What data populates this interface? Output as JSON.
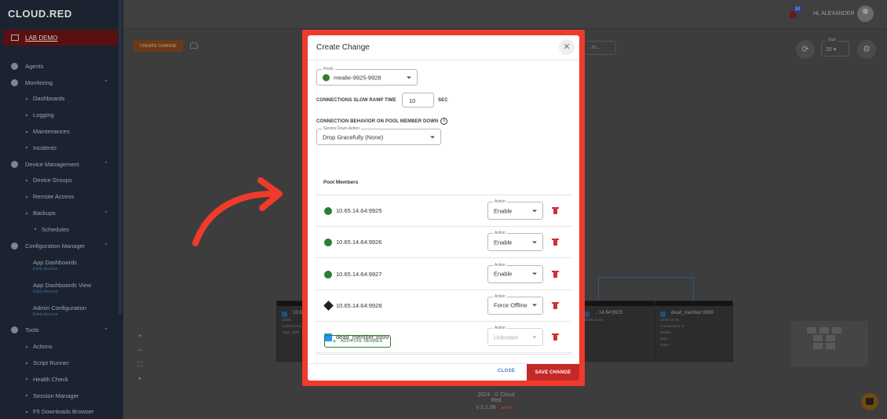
{
  "app": {
    "logo_main": "CL",
    "logo_accent": "OUD",
    "logo_tail": "RED",
    "logo_full": "CLOUD.RED"
  },
  "sidebar": {
    "lab": "LAB DEMO",
    "items": [
      {
        "kind": "sec",
        "label": "Agents",
        "icon": "agents-icon"
      },
      {
        "kind": "sec",
        "label": "Monitoring",
        "icon": "monitoring-icon",
        "caret": "^"
      },
      {
        "kind": "sub",
        "label": "Dashboards"
      },
      {
        "kind": "sub",
        "label": "Logging"
      },
      {
        "kind": "sub",
        "label": "Maintenances"
      },
      {
        "kind": "sub",
        "label": "Incidents"
      },
      {
        "kind": "sec",
        "label": "Device Management",
        "icon": "device-management-icon",
        "caret": "^"
      },
      {
        "kind": "sub",
        "label": "Device Groups"
      },
      {
        "kind": "sub",
        "label": "Remote Access"
      },
      {
        "kind": "sub",
        "label": "Backups",
        "caret": "^"
      },
      {
        "kind": "subsub",
        "label": "Schedules"
      },
      {
        "kind": "sec",
        "label": "Configuration Manager",
        "icon": "configuration-manager-icon",
        "caret": "^"
      },
      {
        "kind": "two",
        "label": "App Dashboards",
        "beta": "Early Access"
      },
      {
        "kind": "two",
        "label": "App Dashboards View",
        "beta": "Early Access"
      },
      {
        "kind": "two",
        "label": "Admin Configuration",
        "beta": "Early Access"
      },
      {
        "kind": "sec",
        "label": "Tools",
        "icon": "tools-icon",
        "caret": "^"
      },
      {
        "kind": "sub",
        "label": "Actions"
      },
      {
        "kind": "sub",
        "label": "Script Runner"
      },
      {
        "kind": "sub",
        "label": "Health Check"
      },
      {
        "kind": "sub",
        "label": "Session Manager"
      },
      {
        "kind": "sub",
        "label": "F5 Downloads Browser"
      }
    ]
  },
  "topbar": {
    "notifications": "10",
    "greeting": "Hi, ALEXANDER"
  },
  "background": {
    "create_button": "CREATE CHANGE",
    "select_value": "...th...",
    "size_label": "Size",
    "size_value": "20",
    "nodes": [
      {
        "title": "10.6...",
        "sub": "10.65..",
        "lines": [
          "Connections...",
          "Details",
          "Max: ..",
          "Total: 1000"
        ]
      },
      {
        "title": "...14.64:9925",
        "sub": "10.65.14.64",
        "lines": [
          "...",
          "...",
          "..."
        ]
      },
      {
        "title": "dead_member:9999",
        "sub": "10.65.14.78",
        "lines": [
          "Connections: 0",
          "Details",
          "Max: -",
          "Total: -"
        ]
      }
    ],
    "footer_year": "2024 · © Cloud Red",
    "footer_version": "v 2.1.36",
    "footer_pill": "admin"
  },
  "modal": {
    "title": "Create Change",
    "pool_label": "Pools",
    "pool_value": "mealie-9925-9928",
    "ramp_label": "CONNECTIONS SLOW RAMP TIME",
    "ramp_value": "10",
    "ramp_unit": "SEC",
    "behavior_label": "CONNECTION BEHAVIOR ON POOL MEMBER DOWN",
    "service_down_label": "Service Down Action",
    "service_down_value": "Drop Gracefully (None)",
    "pool_members_header": "Pool Members",
    "action_label": "Action",
    "members": [
      {
        "address": "10.65.14.64:9925",
        "status": "green",
        "action": "Enable"
      },
      {
        "address": "10.65.14.64:9926",
        "status": "green",
        "action": "Enable"
      },
      {
        "address": "10.65.14.64:9927",
        "status": "green",
        "action": "Enable"
      },
      {
        "address": "10.65.14.64:9928",
        "status": "black",
        "action": "Force Offline"
      },
      {
        "address": "dead_member:9999",
        "status": "blue",
        "action": "Unknown"
      }
    ],
    "add_member": "ADD POOL MEMBER",
    "close": "CLOSE",
    "save": "SAVE CHANGE"
  },
  "colors": {
    "frame": "#f03a2b",
    "save": "#c62828",
    "status_green": "#2e7d32",
    "status_blue": "#2196f3",
    "arrow": "#f03a2b"
  }
}
